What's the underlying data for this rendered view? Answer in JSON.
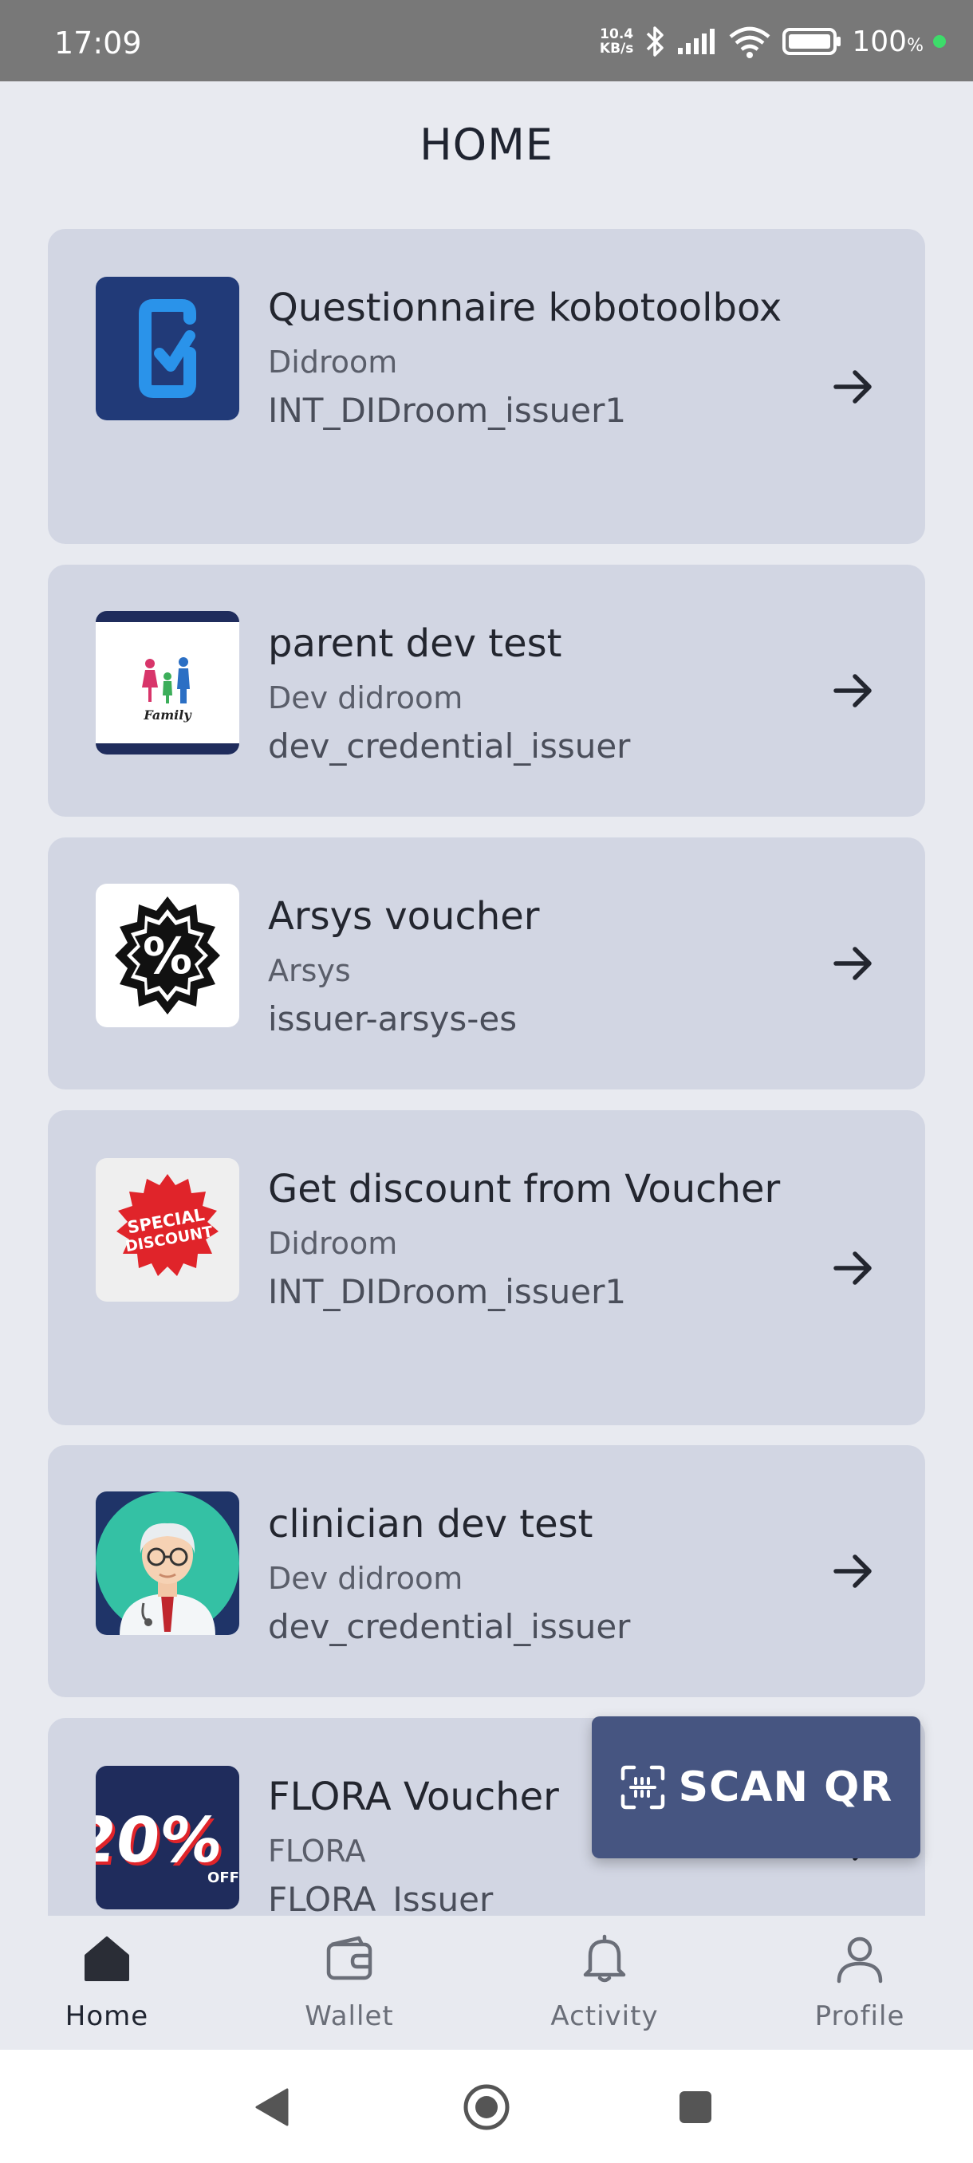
{
  "status_bar": {
    "time": "17:09",
    "net_speed_value": "10.4",
    "net_speed_unit": "KB/s",
    "battery_percent": "100",
    "battery_percent_sign": "%"
  },
  "page": {
    "title": "HOME"
  },
  "cards": [
    {
      "title": "Questionnaire kobotoolbox",
      "issuer": "Didroom",
      "issuer_id": "INT_DIDroom_issuer1",
      "logo": "checkbox-logo-icon"
    },
    {
      "title": "parent dev test",
      "issuer": "Dev didroom",
      "issuer_id": "dev_credential_issuer",
      "logo": "family-logo-icon",
      "logo_text": "Family"
    },
    {
      "title": "Arsys voucher",
      "issuer": "Arsys",
      "issuer_id": "issuer-arsys-es",
      "logo": "percent-badge-icon",
      "logo_text": "%"
    },
    {
      "title": "Get discount from Voucher",
      "issuer": "Didroom",
      "issuer_id": "INT_DIDroom_issuer1",
      "logo": "special-discount-icon",
      "logo_text_1": "SPECIAL",
      "logo_text_2": "DISCOUNT"
    },
    {
      "title": "clinician dev test",
      "issuer": "Dev didroom",
      "issuer_id": "dev_credential_issuer",
      "logo": "doctor-avatar-icon"
    },
    {
      "title": "FLORA Voucher",
      "issuer": "FLORA",
      "issuer_id": "FLORA_Issuer",
      "logo": "twenty-percent-off-icon",
      "logo_text_1": "20%",
      "logo_text_2": "OFF"
    }
  ],
  "scan_button": {
    "label": "SCAN QR"
  },
  "bottom_nav": [
    {
      "label": "Home",
      "icon": "home-icon",
      "active": true
    },
    {
      "label": "Wallet",
      "icon": "wallet-icon",
      "active": false
    },
    {
      "label": "Activity",
      "icon": "bell-icon",
      "active": false
    },
    {
      "label": "Profile",
      "icon": "user-icon",
      "active": false
    }
  ],
  "colors": {
    "background": "#e8eaf0",
    "card": "#d2d6e3",
    "accent_button": "#465581",
    "status_bar": "#787878"
  }
}
